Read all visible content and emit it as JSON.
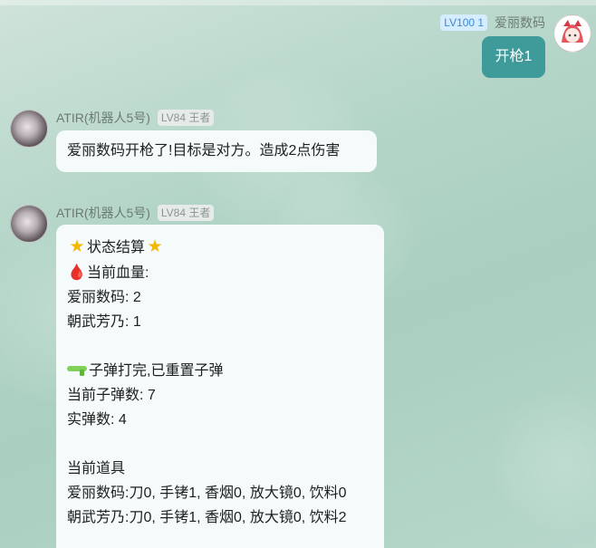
{
  "messages": {
    "self": {
      "level": "LV100 1",
      "name": "爱丽数码",
      "text": "开枪1"
    },
    "bot1": {
      "name": "ATIR(机器人5号)",
      "level": "LV84 王者",
      "text": "爱丽数码开枪了!目标是对方。造成2点伤害"
    },
    "bot2": {
      "name": "ATIR(机器人5号)",
      "level": "LV84 王者",
      "title": "状态结算",
      "hp_label": "当前血量:",
      "hp_player1": "爱丽数码: 2",
      "hp_player2": "朝武芳乃: 1",
      "reload": "子弹打完,已重置子弹",
      "bullets": "当前子弹数: 7",
      "live_rounds": "实弹数: 4",
      "items_label": "当前道具",
      "items_player1": "爱丽数码:刀0, 手铐1, 香烟0, 放大镜0, 饮料0",
      "items_player2": "朝武芳乃:刀0, 手铐1, 香烟0, 放大镜0, 饮料2"
    }
  },
  "icons": {
    "star": "★",
    "blood_drop": "🩸",
    "water_gun": "water-gun-icon"
  },
  "colors": {
    "self_bubble": "#3f9a9a",
    "bot_bubble": "#f5fbfb",
    "level_badge_blue": "#d6ecff",
    "level_badge_gray": "#e6ebe9"
  }
}
